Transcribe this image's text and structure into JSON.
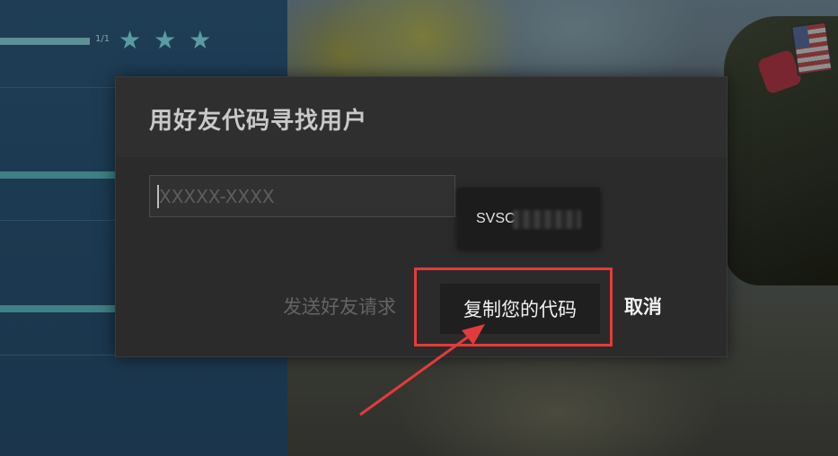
{
  "background": {
    "progress_count": "1/1",
    "stars": [
      "★",
      "★",
      "★"
    ]
  },
  "dialog": {
    "title": "用好友代码寻找用户",
    "code_input": {
      "value": "",
      "placeholder": "XXXXX-XXXX"
    },
    "friend_code_tooltip": {
      "visible_prefix": "SVSC"
    },
    "buttons": {
      "send_request": "发送好友请求",
      "copy_code": "复制您的代码",
      "cancel": "取消"
    }
  },
  "colors": {
    "annotation": "#e33b3b",
    "dialog_bg": "#2b2b2b",
    "accent_teal": "#5b9aa2"
  }
}
